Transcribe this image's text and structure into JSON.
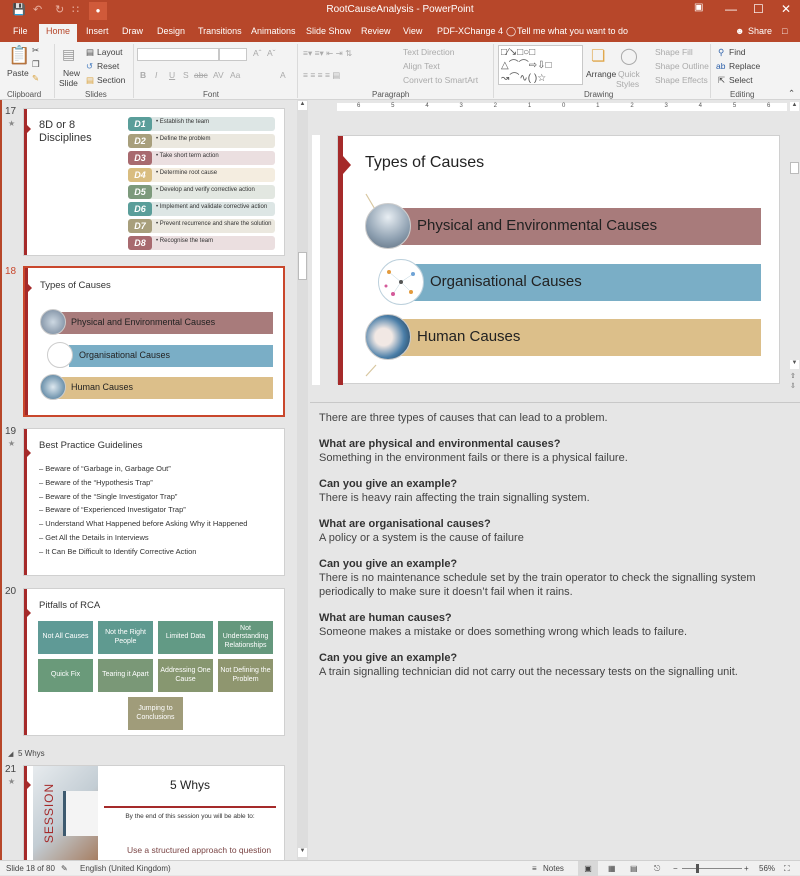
{
  "app": {
    "title": "RootCauseAnalysis - PowerPoint",
    "accent_color": "#b7472a"
  },
  "qat": {
    "save": "save-icon",
    "undo": "undo-icon",
    "redo": "redo-icon",
    "present": "present-icon"
  },
  "window_controls": [
    "ribbon-display-icon",
    "minimize-icon",
    "maximize-icon",
    "close-icon"
  ],
  "tabs": [
    "File",
    "Home",
    "Insert",
    "Draw",
    "Design",
    "Transitions",
    "Animations",
    "Slide Show",
    "Review",
    "View",
    "PDF-XChange 4"
  ],
  "active_tab": "Home",
  "tell_me": "Tell me what you want to do",
  "share": "Share",
  "ribbon": {
    "clipboard": {
      "paste": "Paste",
      "group": "Clipboard"
    },
    "slides": {
      "new_slide": "New",
      "new_slide2": "Slide",
      "layout": "Layout",
      "reset": "Reset",
      "section": "Section",
      "group": "Slides"
    },
    "font": {
      "group": "Font",
      "buttons": [
        "B",
        "I",
        "U",
        "S",
        "abc",
        "AV",
        "Aa",
        "A"
      ]
    },
    "paragraph": {
      "group": "Paragraph",
      "text_direction": "Text Direction",
      "align_text": "Align Text",
      "convert_smartart": "Convert to SmartArt"
    },
    "drawing": {
      "group": "Drawing",
      "arrange": "Arrange",
      "quick_styles": "Quick",
      "quick_styles2": "Styles",
      "shape_fill": "Shape Fill",
      "shape_outline": "Shape Outline",
      "shape_effects": "Shape Effects"
    },
    "editing": {
      "group": "Editing",
      "find": "Find",
      "replace": "Replace",
      "select": "Select"
    }
  },
  "thumbnails": {
    "s17": {
      "num": "17",
      "title": "8D or 8 Disciplines",
      "rows": [
        {
          "badge": "D1",
          "text": "• Establish the team",
          "color": "#5a9e9a",
          "bg": "#dde6e5"
        },
        {
          "badge": "D2",
          "text": "• Define the problem",
          "color": "#a89f7c",
          "bg": "#ebe8df"
        },
        {
          "badge": "D3",
          "text": "• Take short term action",
          "color": "#a86a6f",
          "bg": "#ebdfe0"
        },
        {
          "badge": "D4",
          "text": "• Determine root cause",
          "color": "#d9bd80",
          "bg": "#f4ede0"
        },
        {
          "badge": "D5",
          "text": "• Develop and verify corrective action",
          "color": "#7d9a7c",
          "bg": "#e2e7e1"
        },
        {
          "badge": "D6",
          "text": "• Implement and validate corrective action",
          "color": "#5a9e9a",
          "bg": "#dde6e5"
        },
        {
          "badge": "D7",
          "text": "• Prevent recurrence and share the solution",
          "color": "#a89f7c",
          "bg": "#ebe8df"
        },
        {
          "badge": "D8",
          "text": "• Recognise the team",
          "color": "#a86a6f",
          "bg": "#ebdfe0"
        }
      ]
    },
    "s18": {
      "num": "18",
      "title": "Types of Causes"
    },
    "s19": {
      "num": "19",
      "title": "Best Practice Guidelines",
      "items": [
        "– Beware of “Garbage in, Garbage Out”",
        "– Beware of the “Hypothesis Trap”",
        "– Beware of the “Single Investigator Trap”",
        "– Beware of “Experienced Investigator Trap”",
        "– Understand What Happened before Asking Why it Happened",
        "– Get All the Details in Interviews",
        "– It Can Be Difficult to Identify Corrective Action"
      ]
    },
    "s20": {
      "num": "20",
      "title": "Pitfalls of RCA",
      "tiles": [
        {
          "label": "Not All Causes",
          "color": "#5f9a96"
        },
        {
          "label": "Not the Right People",
          "color": "#5f9a90"
        },
        {
          "label": "Limited Data",
          "color": "#629a85"
        },
        {
          "label": "Not Understanding Relationships",
          "color": "#65987d"
        },
        {
          "label": "Quick Fix",
          "color": "#6a9a7a"
        },
        {
          "label": "Tearing it Apart",
          "color": "#7a9877"
        },
        {
          "label": "Addressing One Cause",
          "color": "#879770"
        },
        {
          "label": "Not Defining the Problem",
          "color": "#8f966f"
        },
        {
          "label": "Jumping to Conclusions",
          "color": "#a09c7a"
        }
      ]
    },
    "section": "5 Whys",
    "s21": {
      "num": "21",
      "title": "5 Whys",
      "side": "SESSION",
      "subtitle": "By the end of this session you will be able to:",
      "body": "Use a structured approach to question"
    }
  },
  "slide": {
    "title": "Types of Causes",
    "causes": [
      {
        "label": "Physical and Environmental Causes",
        "color": "#a87b7b",
        "icon": "city-photo-icon"
      },
      {
        "label": "Organisational Causes",
        "color": "#7aaec6",
        "icon": "network-icon"
      },
      {
        "label": "Human Causes",
        "color": "#dcbf8a",
        "icon": "technician-photo-icon"
      }
    ]
  },
  "ruler": [
    "6",
    "5",
    "4",
    "3",
    "2",
    "1",
    "0",
    "1",
    "2",
    "3",
    "4",
    "5",
    "6"
  ],
  "notes": [
    {
      "q": "",
      "a": "There are three types of causes that can lead to a problem."
    },
    {
      "q": "What are physical and environmental causes?",
      "a": "Something in the environment fails or there is a physical failure."
    },
    {
      "q": "Can you give an example?",
      "a": "There is heavy rain affecting the train signalling system."
    },
    {
      "q": "What are organisational causes?",
      "a": "A policy or a system is the cause of failure"
    },
    {
      "q": "Can you give an example?",
      "a": "There is no maintenance schedule set by the train operator to check the signalling system periodically to make sure it doesn’t fail when it rains."
    },
    {
      "q": "What are human causes?",
      "a": "Someone makes a mistake or does something wrong which leads to failure."
    },
    {
      "q": "Can you give an example?",
      "a": "A train signalling technician did not carry out the necessary tests on the signalling unit."
    }
  ],
  "status": {
    "slide": "Slide 18 of 80",
    "language": "English (United Kingdom)",
    "notes": "Notes",
    "zoom": "56%",
    "zoom_level": 0.56
  }
}
